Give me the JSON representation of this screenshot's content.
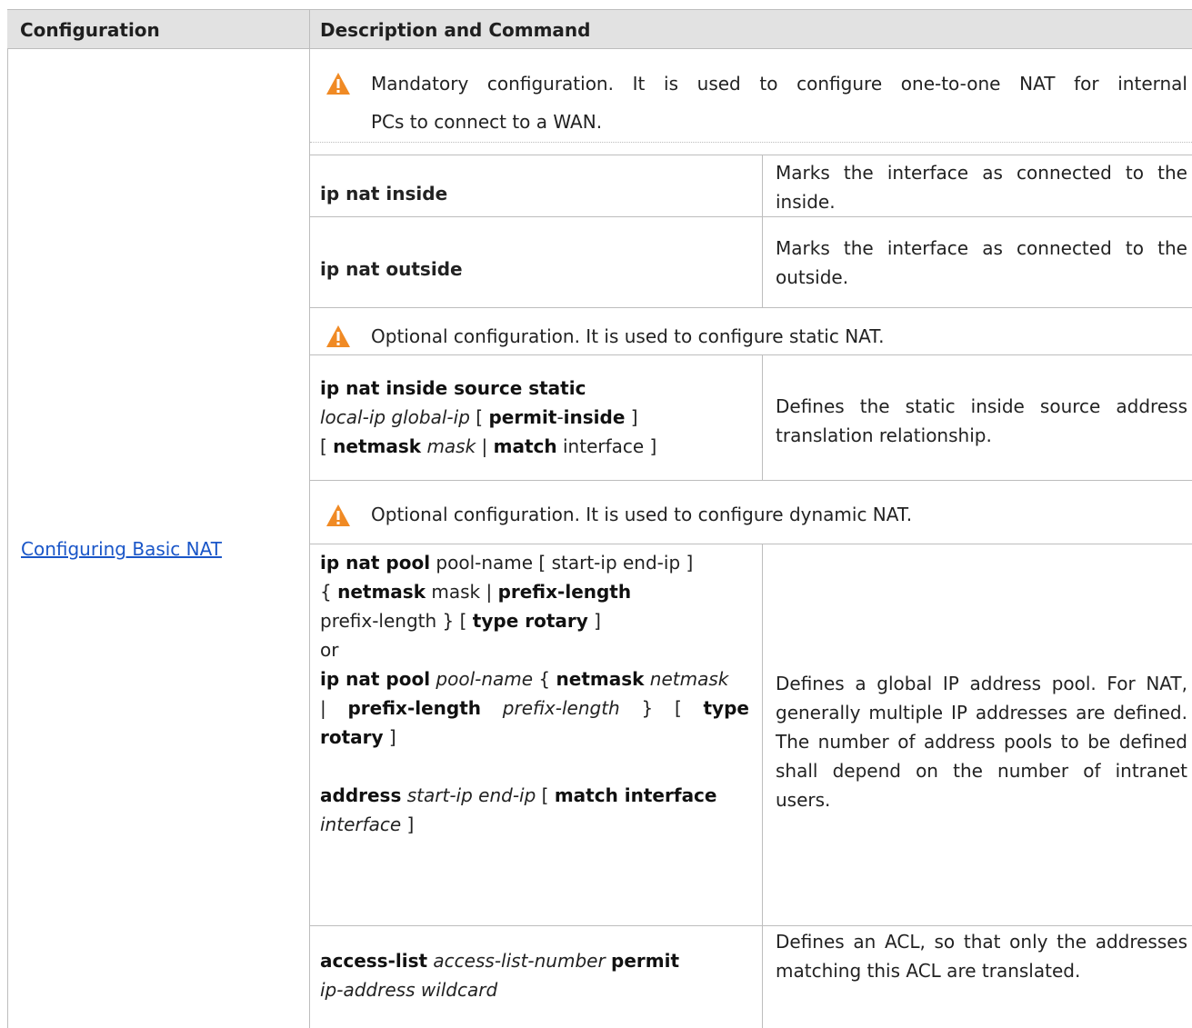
{
  "header": {
    "col1": "Configuration",
    "col2": "Description and Command"
  },
  "config_link": "Configuring Basic NAT",
  "notes": {
    "mandatory_line1": "Mandatory configuration. It is used to configure one-to-one NAT for internal",
    "mandatory_line2": "PCs to connect to a WAN.",
    "static": "Optional configuration. It is used to configure static NAT.",
    "dynamic": "Optional configuration. It is used to configure dynamic NAT."
  },
  "rows": {
    "inside": {
      "command": "ip nat inside",
      "desc": "Marks the interface as connected to the inside."
    },
    "outside": {
      "command": "ip nat outside",
      "desc": "Marks the interface as connected to the outside."
    },
    "static_desc": "Defines the static inside source address translation relationship.",
    "pool_desc": "Defines a global IP address pool. For NAT, generally multiple IP addresses are defined. The number of address pools to be defined shall depend on the number of intranet users.",
    "acl_desc": "Defines an ACL, so that only the addresses matching this ACL are translated."
  },
  "icons": {
    "warning": "warning-triangle-icon",
    "warning_color": "#f08a24"
  }
}
